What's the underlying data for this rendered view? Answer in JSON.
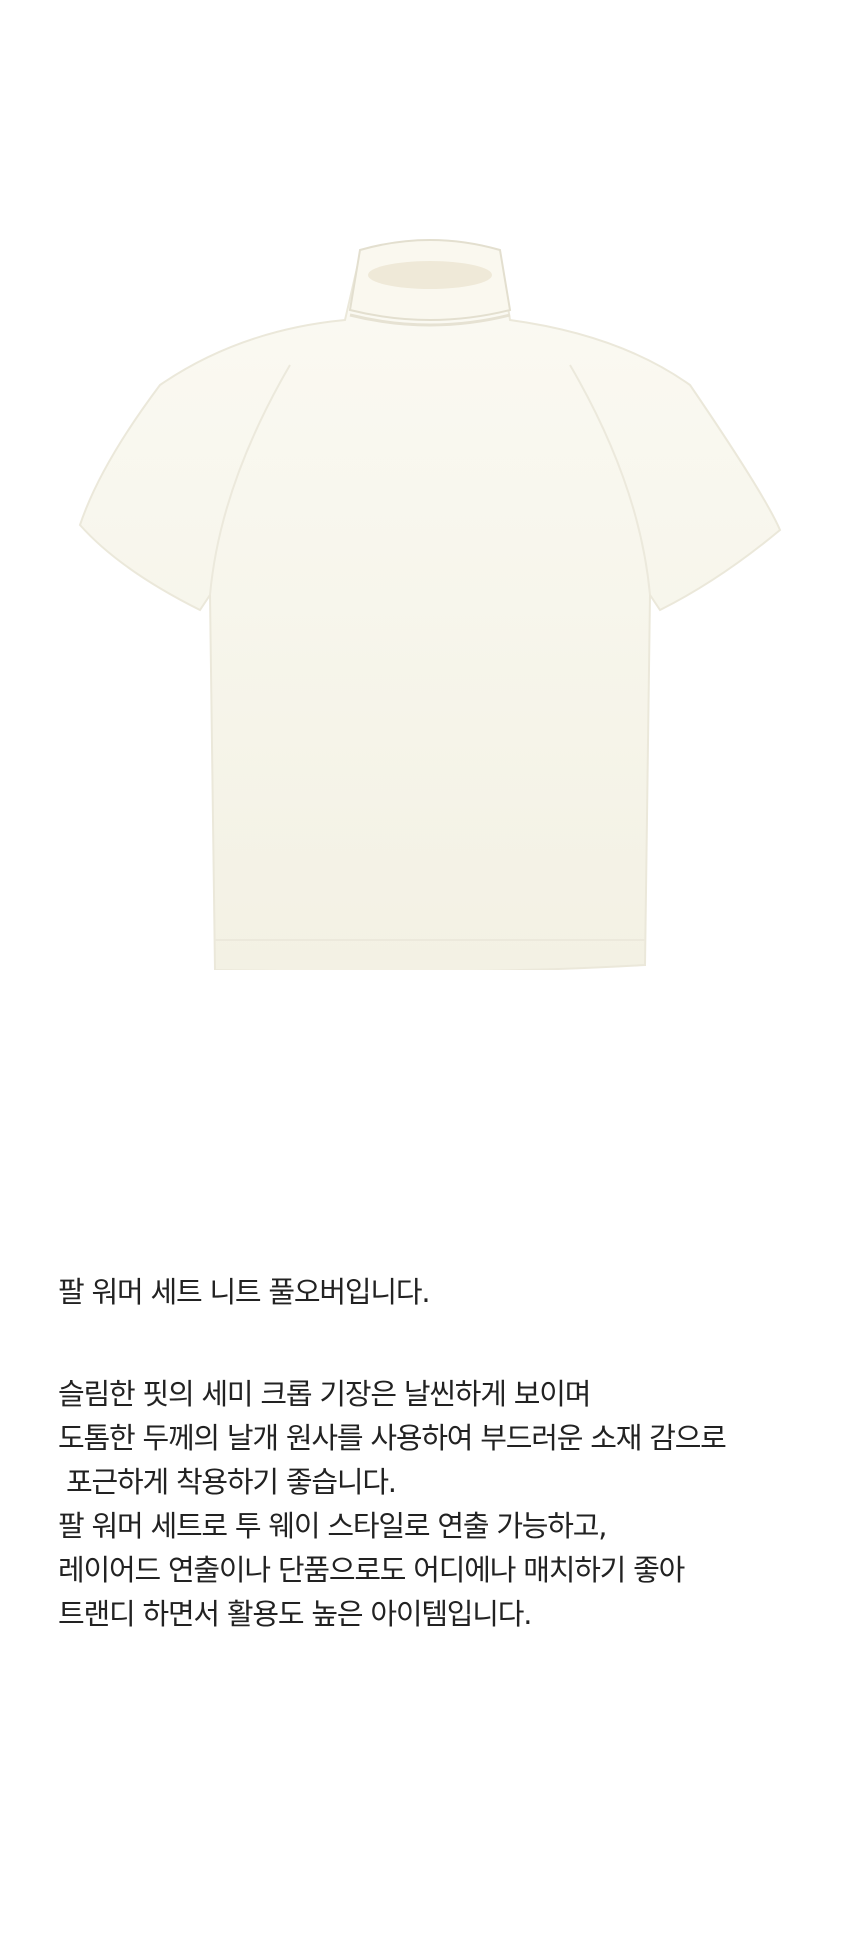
{
  "product": {
    "image_icon": "white-short-sleeve-turtleneck-knit-icon",
    "knit_color": "#f7f5ea",
    "shadow_color": "#e4e0d2"
  },
  "description": {
    "intro": "팔 워머 세트 니트 풀오버입니다.",
    "lines": [
      "슬림한 핏의 세미 크롭 기장은 날씬하게 보이며",
      "도톰한 두께의 날개 원사를 사용하여 부드러운 소재 감으로",
      " 포근하게 착용하기 좋습니다.",
      "팔 워머 세트로 투 웨이 스타일로 연출 가능하고,",
      "레이어드 연출이나 단품으로도 어디에나 매치하기 좋아",
      "트랜디 하면서 활용도 높은 아이템입니다."
    ]
  }
}
